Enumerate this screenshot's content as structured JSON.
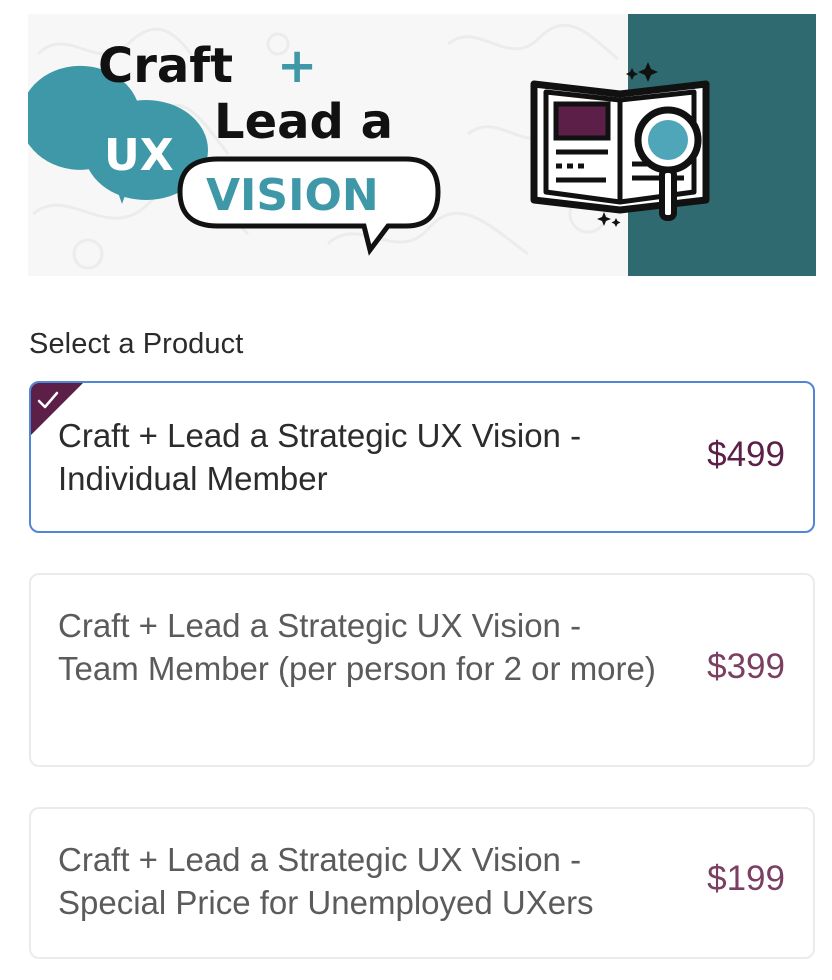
{
  "banner": {
    "logo_line1": "Craft",
    "logo_plus": "+",
    "logo_line2": "Lead a",
    "logo_ux": "UX",
    "logo_vision": "VISION",
    "illustration": "book-magnifier-icon",
    "colors": {
      "teal_panel": "#2e6a70",
      "ux_bubble": "#3f98a8",
      "vision_text": "#3f98a8",
      "book_page": "#5c1f48",
      "magnifier_lens": "#4fa6b8"
    }
  },
  "section_title": "Select a Product",
  "products": [
    {
      "name": "Craft + Lead a Strategic UX Vision - Individual Member",
      "price": "$499",
      "selected": true
    },
    {
      "name": "Craft + Lead a Strategic UX Vision - Team Member (per person for 2 or more)",
      "price": "$399",
      "selected": false
    },
    {
      "name": "Craft + Lead a Strategic UX Vision - Special Price for Unemployed UXers",
      "price": "$199",
      "selected": false
    }
  ],
  "colors": {
    "selected_border": "#4f86d6",
    "check_corner": "#5c1f48",
    "price": "#5c1f48"
  },
  "icons": {
    "selected_marker": "checkmark-icon"
  }
}
